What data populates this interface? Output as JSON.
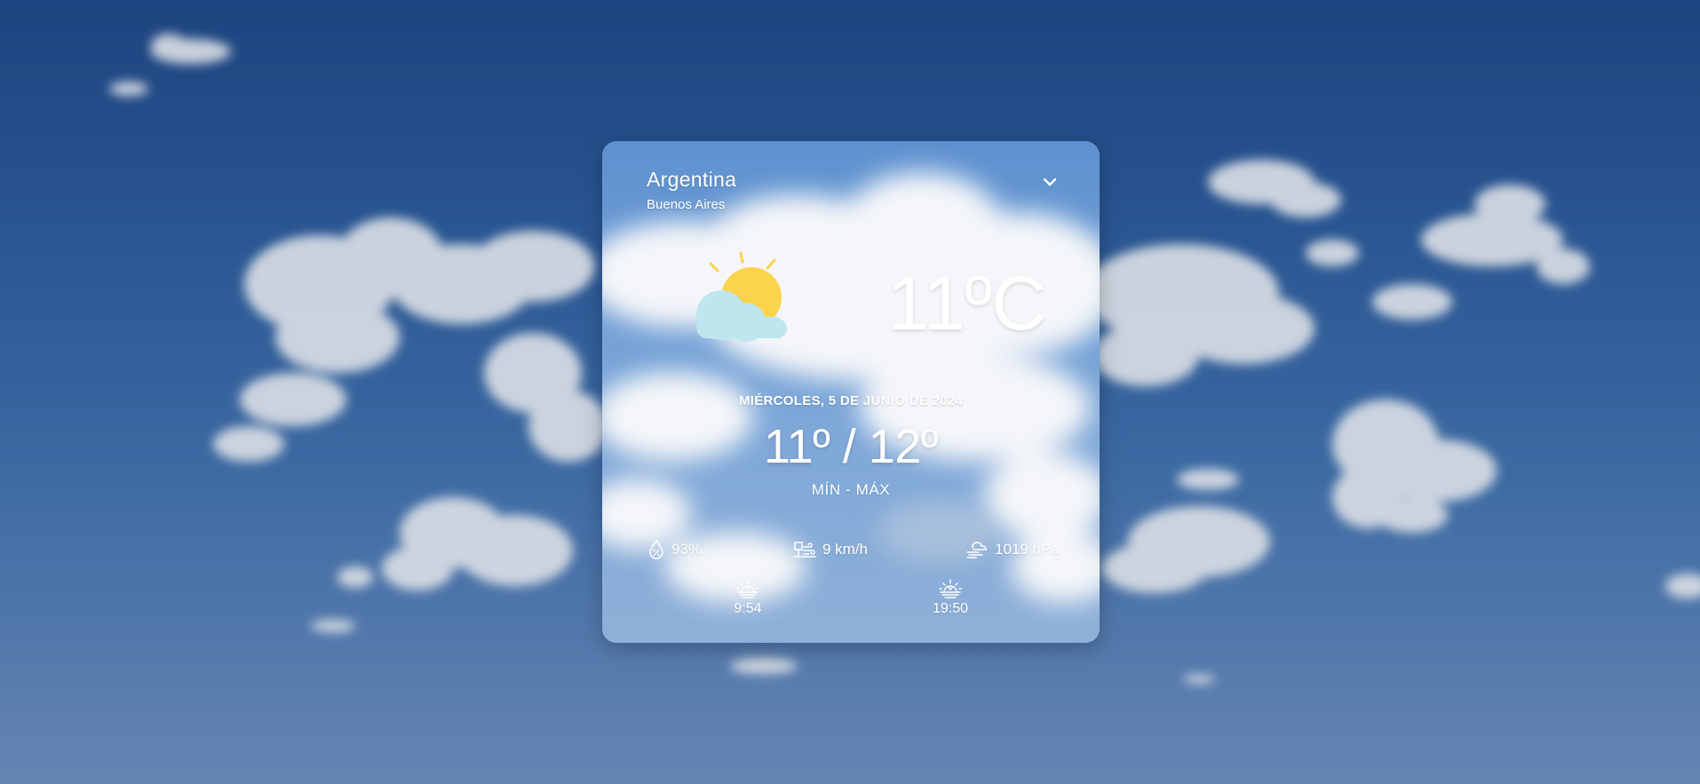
{
  "location": {
    "country": "Argentina",
    "city": "Buenos Aires"
  },
  "current": {
    "temperature": "11ºC",
    "condition_icon": "partly-cloudy-icon",
    "date": "MIÉRCOLES, 5 DE JUNIO DE 2024",
    "min_max": "11º / 12º",
    "min_max_label": "MÍN - MÁX"
  },
  "stats": {
    "humidity": "93%",
    "wind": "9 km/h",
    "pressure": "1019 hPa"
  },
  "sun": {
    "sunrise": "9:54",
    "sunset": "19:50"
  },
  "icons": {
    "dropdown": "chevron-down-icon",
    "humidity": "humidity-drop-icon",
    "wind": "wind-icon",
    "pressure": "pressure-icon",
    "sunrise": "sunrise-icon",
    "sunset": "sunset-icon"
  },
  "colors": {
    "sun": "#fcd34d",
    "cloud_icon": "#bde6ef",
    "sky_top": "#1d447f",
    "sky_bottom": "#6585b3",
    "text": "#ffffff"
  }
}
